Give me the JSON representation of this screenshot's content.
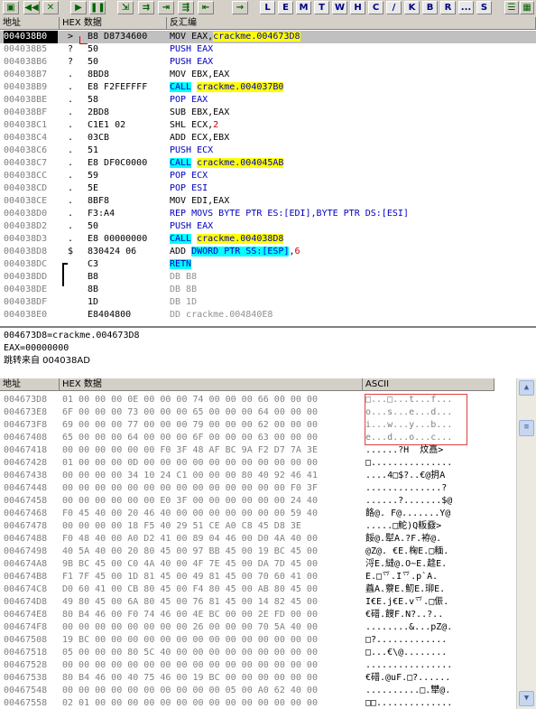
{
  "toolbar": {
    "buttons": [
      {
        "name": "open-icon",
        "glyph": "▣"
      },
      {
        "name": "restart-icon",
        "glyph": "◀◀"
      },
      {
        "name": "close-icon",
        "glyph": "✕"
      },
      {
        "name": "run-icon",
        "glyph": "▶"
      },
      {
        "name": "pause-icon",
        "glyph": "❚❚"
      },
      {
        "name": "step-into-icon",
        "glyph": "⇲"
      },
      {
        "name": "step-over-icon",
        "glyph": "⇉"
      },
      {
        "name": "trace-into-icon",
        "glyph": "⇥"
      },
      {
        "name": "trace-over-icon",
        "glyph": "⇶"
      },
      {
        "name": "execute-till-return-icon",
        "glyph": "⇤"
      },
      {
        "name": "goto-icon",
        "glyph": "→"
      }
    ],
    "letters": [
      "L",
      "E",
      "M",
      "T",
      "W",
      "H",
      "C",
      "/",
      "K",
      "B",
      "R",
      "...",
      "S"
    ],
    "right_icons": [
      {
        "name": "list-icon",
        "glyph": "☰"
      },
      {
        "name": "grid-icon",
        "glyph": "▦"
      }
    ]
  },
  "disasm": {
    "headers": {
      "addr": "地址",
      "hex": "HEX 数据",
      "disasm": "反汇编"
    },
    "rows": [
      {
        "addr": "004038B0",
        "mark": ">",
        "hex": "B8 D8734600",
        "parts": [
          [
            "MOV EAX,",
            ""
          ],
          [
            "crackme.004673D8",
            "yellow"
          ]
        ],
        "current": true
      },
      {
        "addr": "004038B5",
        "mark": "?",
        "hex": "50",
        "parts": [
          [
            "PUSH EAX",
            "blue"
          ]
        ]
      },
      {
        "addr": "004038B6",
        "mark": "?",
        "hex": "50",
        "parts": [
          [
            "PUSH EAX",
            "blue"
          ]
        ]
      },
      {
        "addr": "004038B7",
        "mark": ".",
        "hex": "8BD8",
        "parts": [
          [
            "MOV EBX,EAX",
            ""
          ]
        ]
      },
      {
        "addr": "004038B9",
        "mark": ".",
        "hex": "E8 F2FEFFFF",
        "parts": [
          [
            "CALL",
            "cyan"
          ],
          [
            " ",
            ""
          ],
          [
            "crackme.004037B0",
            "yellow"
          ]
        ]
      },
      {
        "addr": "004038BE",
        "mark": ".",
        "hex": "58",
        "parts": [
          [
            "POP EAX",
            "blue"
          ]
        ]
      },
      {
        "addr": "004038BF",
        "mark": ".",
        "hex": "2BD8",
        "parts": [
          [
            "SUB EBX,EAX",
            ""
          ]
        ]
      },
      {
        "addr": "004038C1",
        "mark": ".",
        "hex": "C1E1 02",
        "parts": [
          [
            "SHL ECX,",
            ""
          ],
          [
            "2",
            "red"
          ]
        ]
      },
      {
        "addr": "004038C4",
        "mark": ".",
        "hex": "03CB",
        "parts": [
          [
            "ADD ECX,EBX",
            ""
          ]
        ]
      },
      {
        "addr": "004038C6",
        "mark": ".",
        "hex": "51",
        "parts": [
          [
            "PUSH ECX",
            "blue"
          ]
        ]
      },
      {
        "addr": "004038C7",
        "mark": ".",
        "hex": "E8 DF0C0000",
        "parts": [
          [
            "CALL",
            "cyan"
          ],
          [
            " ",
            ""
          ],
          [
            "crackme.004045AB",
            "yellow"
          ]
        ]
      },
      {
        "addr": "004038CC",
        "mark": ".",
        "hex": "59",
        "parts": [
          [
            "POP ECX",
            "blue"
          ]
        ]
      },
      {
        "addr": "004038CD",
        "mark": ".",
        "hex": "5E",
        "parts": [
          [
            "POP ESI",
            "blue"
          ]
        ]
      },
      {
        "addr": "004038CE",
        "mark": ".",
        "hex": "8BF8",
        "parts": [
          [
            "MOV EDI,EAX",
            ""
          ]
        ]
      },
      {
        "addr": "004038D0",
        "mark": ".",
        "hex": "F3:A4",
        "parts": [
          [
            "REP MOVS BYTE PTR ES:[EDI],BYTE PTR DS:[ESI]",
            "blue"
          ]
        ]
      },
      {
        "addr": "004038D2",
        "mark": ".",
        "hex": "50",
        "parts": [
          [
            "PUSH EAX",
            "blue"
          ]
        ]
      },
      {
        "addr": "004038D3",
        "mark": ".",
        "hex": "E8 00000000",
        "parts": [
          [
            "CALL",
            "cyan"
          ],
          [
            " ",
            ""
          ],
          [
            "crackme.004038D8",
            "yellow"
          ]
        ]
      },
      {
        "addr": "004038D8",
        "mark": "$",
        "hex": "830424 06",
        "parts": [
          [
            "ADD ",
            ""
          ],
          [
            "DWORD PTR SS:[ESP]",
            "cyan"
          ],
          [
            ",",
            ""
          ],
          [
            "6",
            "red"
          ]
        ]
      },
      {
        "addr": "004038DC",
        "mark": "",
        "hex": "C3",
        "parts": [
          [
            "RETN",
            "cyan"
          ]
        ]
      },
      {
        "addr": "004038DD",
        "mark": "",
        "hex": "B8",
        "parts": [
          [
            "DB B8",
            "gray"
          ]
        ]
      },
      {
        "addr": "004038DE",
        "mark": "",
        "hex": "8B",
        "parts": [
          [
            "DB 8B",
            "gray"
          ]
        ]
      },
      {
        "addr": "004038DF",
        "mark": "",
        "hex": "1D",
        "parts": [
          [
            "DB 1D",
            "gray"
          ]
        ]
      },
      {
        "addr": "004038E0",
        "mark": "",
        "hex": "E8404800",
        "parts": [
          [
            "DD crackme.004840E8",
            "gray"
          ]
        ]
      }
    ]
  },
  "info": {
    "line1": "004673D8=crackme.004673D8",
    "line2": "EAX=00000000",
    "line3": "跳转来自 004038AD"
  },
  "dump": {
    "headers": {
      "addr": "地址",
      "hex": "HEX 数据",
      "ascii": "ASCII"
    },
    "rows": [
      {
        "addr": "004673D8",
        "hex": "01 00 00 00 0E 00 00 00 74 00 00 00 66 00 00 00",
        "ascii": "□...□...t...f..."
      },
      {
        "addr": "004673E8",
        "hex": "6F 00 00 00 73 00 00 00 65 00 00 00 64 00 00 00",
        "ascii": "o...s...e...d..."
      },
      {
        "addr": "004673F8",
        "hex": "69 00 00 00 77 00 00 00 79 00 00 00 62 00 00 00",
        "ascii": "i...w...y...b..."
      },
      {
        "addr": "00467408",
        "hex": "65 00 00 00 64 00 00 00 6F 00 00 00 63 00 00 00",
        "ascii": "e...d...o...c..."
      },
      {
        "addr": "00467418",
        "hex": "00 00 00 00 00 00 F0 3F 48 AF BC 9A F2 D7 7A 3E",
        "ascii": "......?H  炆譶>"
      },
      {
        "addr": "00467428",
        "hex": "01 00 00 00 0D 00 00 00 00 00 00 00 00 00 00 00",
        "ascii": "□..............."
      },
      {
        "addr": "00467438",
        "hex": "00 00 00 00 34 10 24 C1 00 00 00 80 40 92 46 41",
        "ascii": "....4□$?..€@抈A"
      },
      {
        "addr": "00467448",
        "hex": "00 00 00 00 00 00 00 00 00 00 00 00 00 00 F0 3F",
        "ascii": "..............?"
      },
      {
        "addr": "00467458",
        "hex": "00 00 00 00 00 00 E0 3F 00 00 00 00 00 00 24 40",
        "ascii": "......?.......$@"
      },
      {
        "addr": "00467468",
        "hex": "F0 45 40 00 20 46 40 00 00 00 00 00 00 00 59 40",
        "ascii": "餎@. F@.......Y@"
      },
      {
        "addr": "00467478",
        "hex": "00 00 00 00 18 F5 40 29 51 CE A0 C8 45 D8 3E",
        "ascii": ".....□鮀)Q粄鼗>"
      },
      {
        "addr": "00467488",
        "hex": "F0 48 40 00 A0 D2 41 00 89 04 46 00 D0 4A 40 00",
        "ascii": "餒@.犚A.?F.袸@."
      },
      {
        "addr": "00467498",
        "hex": "40 5A 40 00 20 80 45 00 97 BB 45 00 19 BC 45 00",
        "ascii": "@Z@. €E.椈E.□糆."
      },
      {
        "addr": "004674A8",
        "hex": "9B BC 45 00 C0 4A 40 00 4F 7E 45 00 DA 7D 45 00",
        "ascii": "浖E.繨@.O~E.趝E."
      },
      {
        "addr": "004674B8",
        "hex": "F1 7F 45 00 1D 81 45 00 49 81 45 00 70 60 41 00",
        "ascii": "E.□乊.I乊.p`A."
      },
      {
        "addr": "004674C8",
        "hex": "D0 60 41 00 CB 80 45 00 F4 80 45 00 AB 80 45 00",
        "ascii": "蠤A.藔E.魛E.珋E."
      },
      {
        "addr": "004674D8",
        "hex": "49 80 45 00 6A 80 45 00 76 81 45 00 14 82 45 00",
        "ascii": "I€E.j€E.v乊.□侲."
      },
      {
        "addr": "004674E8",
        "hex": "80 B4 46 00 F0 74 46 00 4E BC 00 00 2E FD 00 00",
        "ascii": "€碏.餿F.N?..?.."
      },
      {
        "addr": "004674F8",
        "hex": "00 00 00 00 00 00 00 00 26 00 00 00 70 5A 40 00",
        "ascii": "........&...pZ@."
      },
      {
        "addr": "00467508",
        "hex": "19 BC 00 00 00 00 00 00 00 00 00 00 00 00 00 00",
        "ascii": "□?............."
      },
      {
        "addr": "00467518",
        "hex": "05 00 00 00 80 5C 40 00 00 00 00 00 00 00 00 00",
        "ascii": "□...€\\@........"
      },
      {
        "addr": "00467528",
        "hex": "00 00 00 00 00 00 00 00 00 00 00 00 00 00 00 00",
        "ascii": "................"
      },
      {
        "addr": "00467538",
        "hex": "80 B4 46 00 40 75 46 00 19 BC 00 00 00 00 00 00",
        "ascii": "€碏.@uF.□?......"
      },
      {
        "addr": "00467548",
        "hex": "00 00 00 00 00 00 00 00 00 00 05 00 A0 62 40 00",
        "ascii": "..........□.犫@."
      },
      {
        "addr": "00467558",
        "hex": "02 01 00 00 00 00 00 00 00 00 00 00 00 00 00 00",
        "ascii": "□□.............."
      }
    ]
  },
  "scroll": {
    "up": "▲",
    "down": "▼",
    "thumb": "≡"
  }
}
